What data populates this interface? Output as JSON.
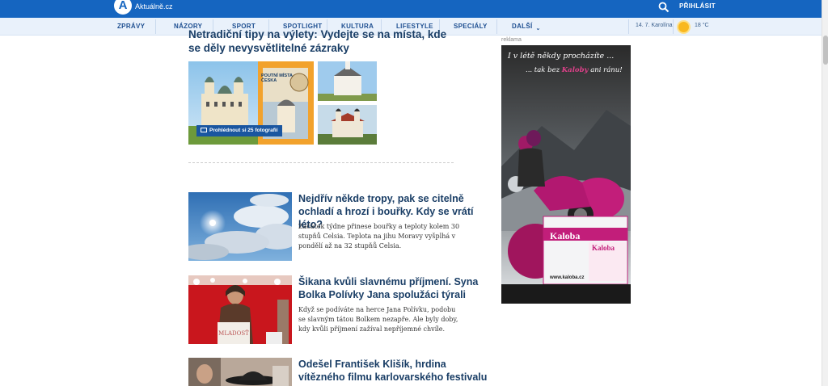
{
  "header": {
    "logo_letter": "A",
    "logo_text": "Aktuálně.cz",
    "login_label": "PŘIHLÁSIT"
  },
  "nav": {
    "items": [
      "ZPRÁVY",
      "NÁZORY",
      "SPORT",
      "SPOTLIGHT",
      "KULTURA",
      "LIFESTYLE",
      "SPECIÁLY",
      "DALŠÍ"
    ],
    "date": "14. 7. Karolína",
    "temperature": "18 °C",
    "weather_icon": "sun-icon"
  },
  "top_article": {
    "title": "Netradiční tipy na výlety: Vydejte se na místa, kde se děly nevysvětlitelné zázraky",
    "gallery_button": "Prohlédnout si 25 fotografií",
    "book_title": "POUTNÍ MÍSTA ČESKA"
  },
  "articles": [
    {
      "title": "Nejdřív někde tropy, pak se citelně ochladí a hrozí i bouřky. Kdy se vrátí léto?",
      "perex": "Začátek týdne přinese bouřky a teploty kolem 30 stupňů Celsia. Teplota na jihu Moravy vyšplhá v pondělí až na 32 stupňů Celsia."
    },
    {
      "title": "Šikana kvůli slavnému příjmení. Syna Bolka Polívky Jana spolužáci týrali",
      "perex": "Když se podíváte na herce Jana Polívku, podobu se slavným tátou Bolkem nezapře. Ale byly doby, kdy kvůli příjmení zažíval nepříjemné chvíle."
    },
    {
      "title": "Odešel František Klišík, hrdina vítězného filmu karlovarského festivalu",
      "perex": ""
    }
  ],
  "ad": {
    "label": "reklama",
    "headline": "I v létě někdy procházíte ...",
    "sub_prefix": "... tak bez",
    "sub_brand": "Kaloby",
    "sub_suffix": "ani ránu!",
    "brand": "Kaloba",
    "url": "www.kaloba.cz"
  },
  "colors": {
    "brand_blue": "#1565c0",
    "title_blue": "#1a3e66",
    "accent_pink": "#e0408a"
  }
}
